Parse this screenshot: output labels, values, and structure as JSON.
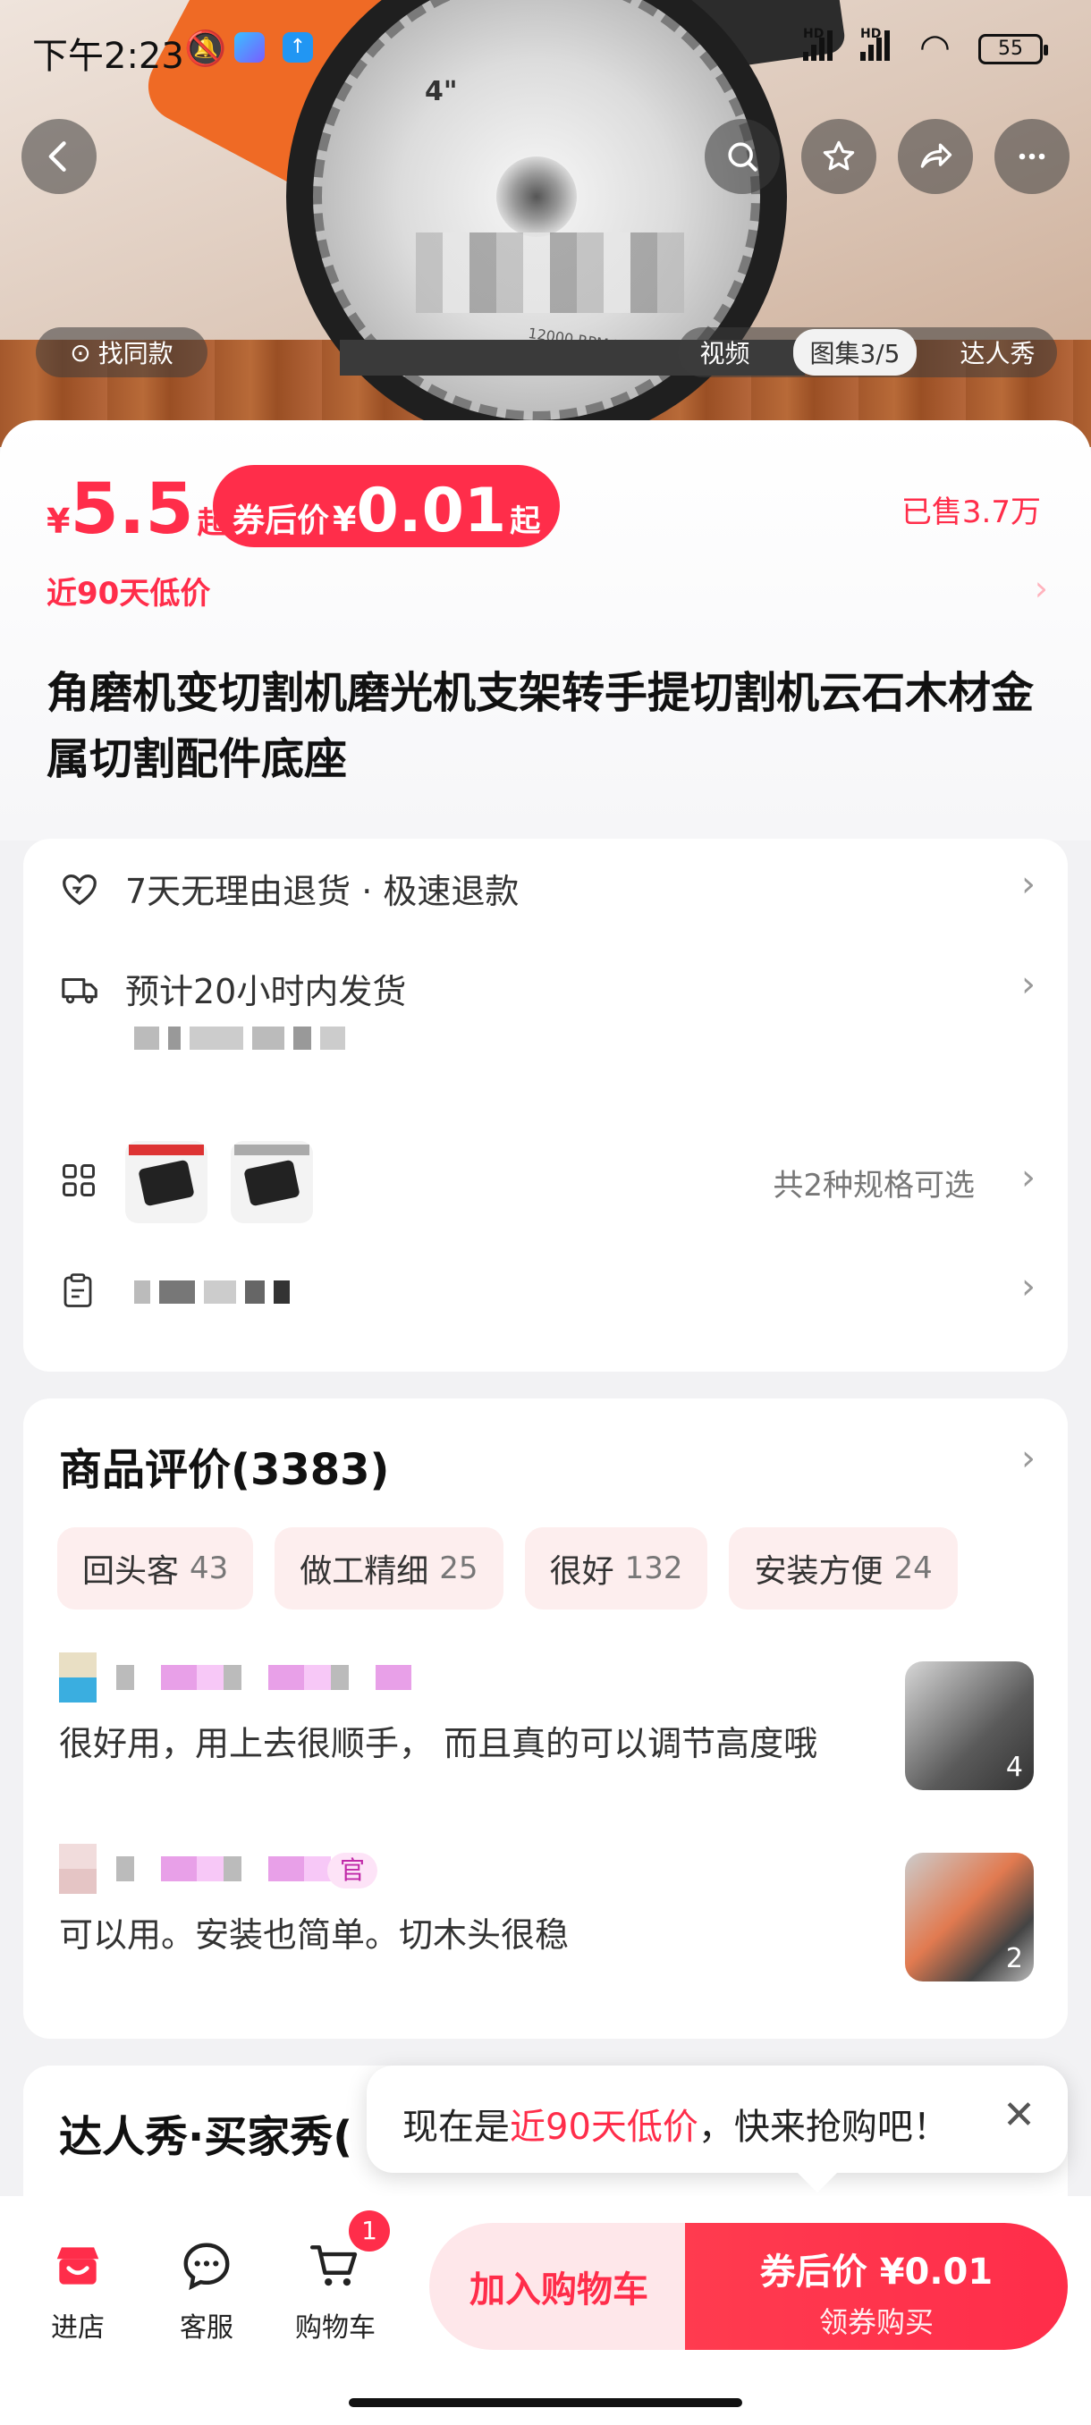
{
  "status_bar": {
    "time": "下午2:23",
    "battery": "55"
  },
  "media": {
    "find_same": "找同款",
    "tabs": [
      "视频",
      "图集3/5",
      "达人秀"
    ]
  },
  "price": {
    "currency": "¥",
    "price": "5.5",
    "from_suffix": "起",
    "coupon_label": "券后价",
    "coupon_price": "0.01",
    "sold": "已售3.7万",
    "low_price_note": "近90天低价"
  },
  "product_title": "角磨机变切割机磨光机支架转手提切割机云石木材金属切割配件底座",
  "services": {
    "return_policy": "7天无理由退货 · 极速退款",
    "shipping": "预计20小时内发货",
    "spec_count": "共2种规格可选"
  },
  "reviews": {
    "title": "商品评价(3383)",
    "tags": [
      {
        "label": "回头客",
        "count": "43"
      },
      {
        "label": "做工精细",
        "count": "25"
      },
      {
        "label": "很好",
        "count": "132"
      },
      {
        "label": "安装方便",
        "count": "24"
      }
    ],
    "items": [
      {
        "text": "很好用，用上去很顺手， 而且真的可以调节高度哦",
        "image_count": "4"
      },
      {
        "text": "可以用。安装也简单。切木头很稳",
        "image_count": "2",
        "badge": "官"
      }
    ]
  },
  "daren": {
    "title": "达人秀·买家秀("
  },
  "toast": {
    "prefix": "现在是",
    "highlight": "近90天低价",
    "suffix": "，快来抢购吧！"
  },
  "bottom_bar": {
    "store": "进店",
    "service": "客服",
    "cart": "购物车",
    "cart_badge": "1",
    "add_to_cart": "加入购物车",
    "buy_line1": "券后价 ¥0.01",
    "buy_line2": "领券购买"
  },
  "colors": {
    "accent": "#ff2d4a",
    "accent_soft": "#fee7ea",
    "tag_bg": "#fdeeee"
  }
}
